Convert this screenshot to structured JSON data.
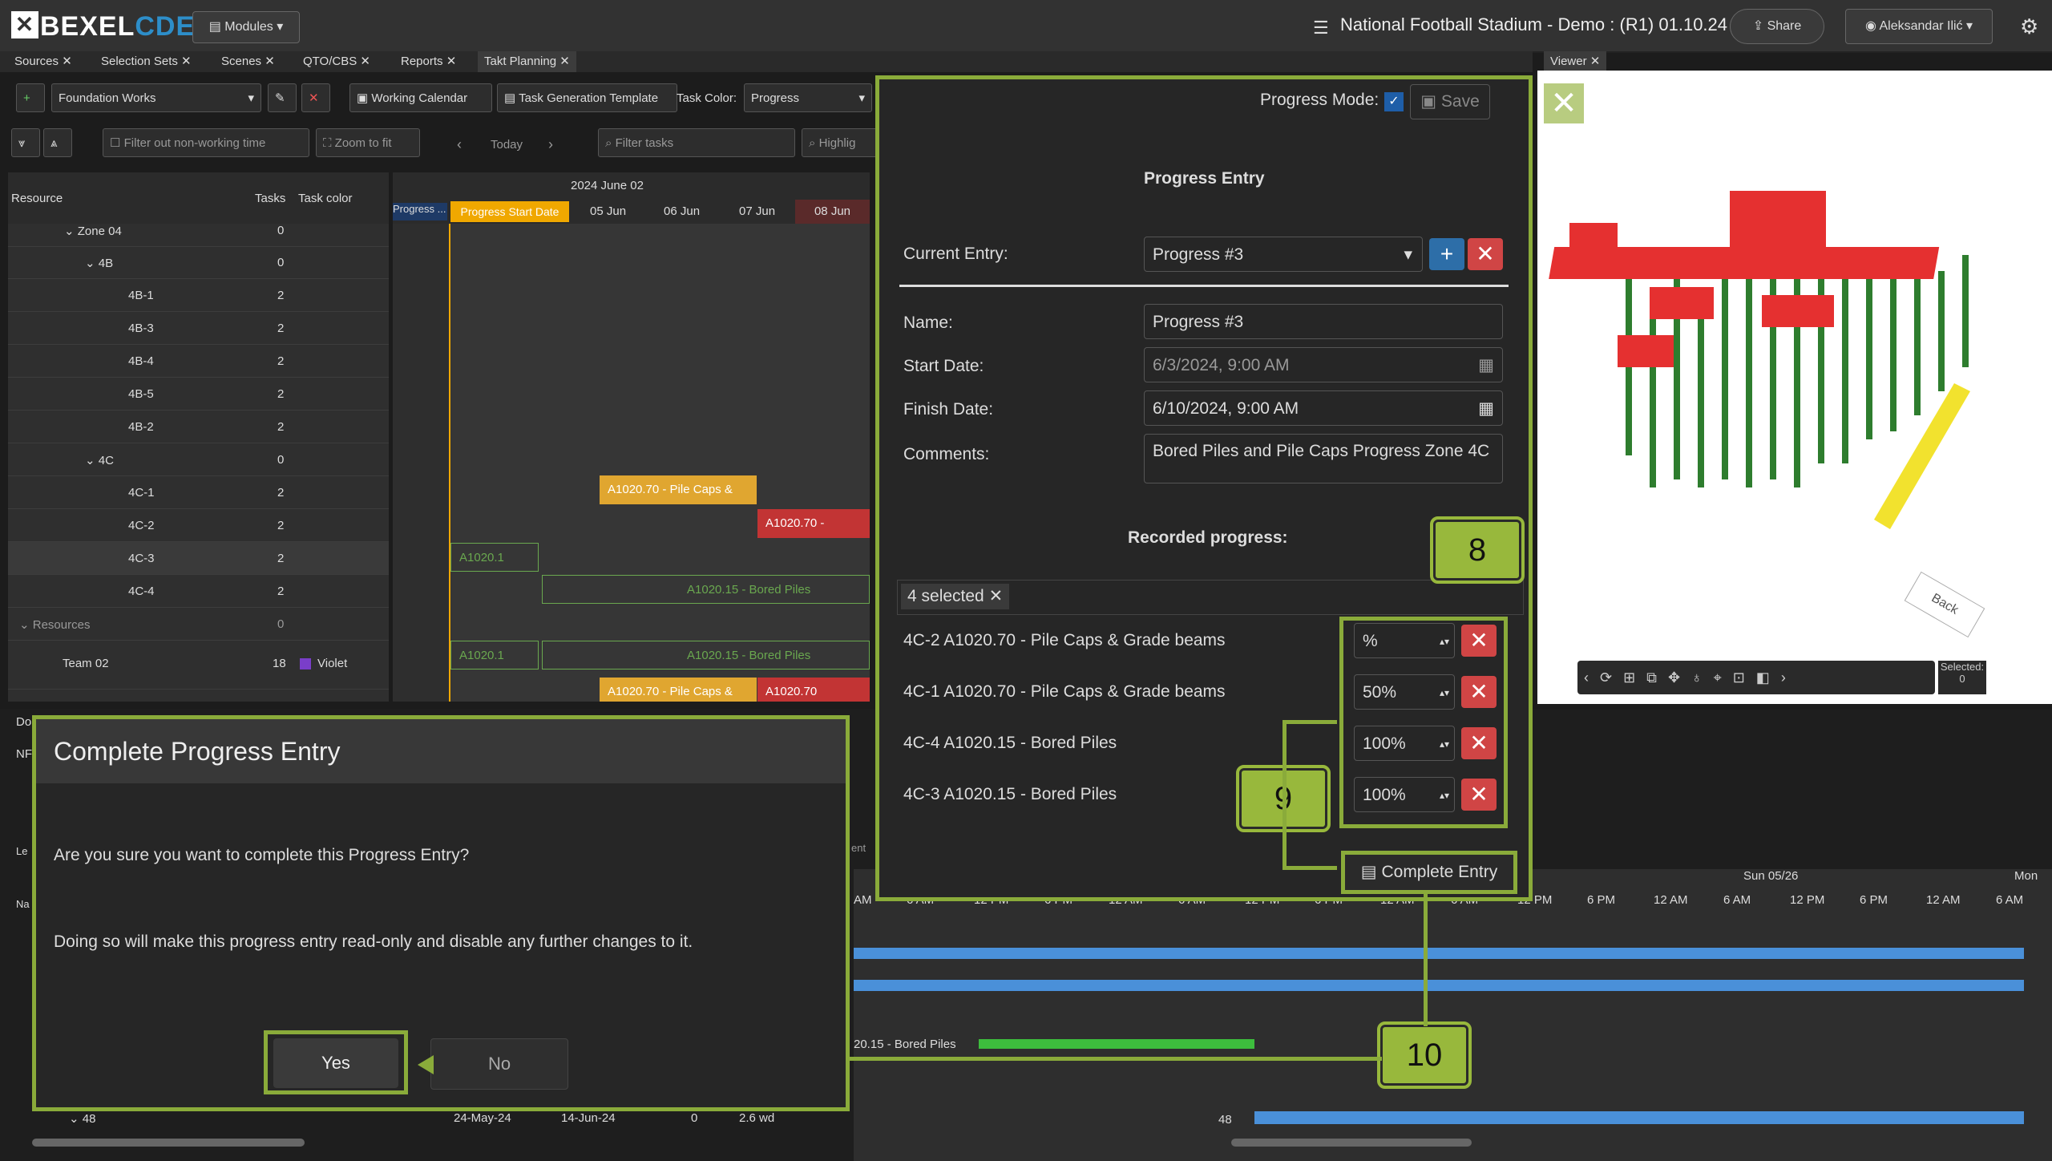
{
  "app": {
    "logo_bexel": "BEXEL",
    "logo_cde": "CDE",
    "modules_label": "Modules",
    "project_title": "National Football Stadium - Demo : (R1) 01.10.24",
    "share_label": "Share",
    "user_name": "Aleksandar Ilić"
  },
  "tabs": [
    "Sources",
    "Selection Sets",
    "Scenes",
    "QTO/CBS",
    "Reports",
    "Takt Planning"
  ],
  "viewer_tab": "Viewer",
  "toolbar": {
    "foundation": "Foundation Works",
    "working_calendar": "Working Calendar",
    "task_template": "Task Generation Template",
    "task_color_label": "Task Color:",
    "task_color_value": "Progress",
    "filter_nonworking": "Filter out non-working time",
    "zoom_to_fit": "Zoom to fit",
    "today": "Today",
    "filter_tasks": "Filter tasks",
    "highlight": "Highlig"
  },
  "gantt": {
    "col_resource": "Resource",
    "col_tasks": "Tasks",
    "col_taskcolor": "Task color",
    "month_label": "2024 June 02",
    "days": [
      "Progress ...",
      "Progress Start Date",
      "05 Jun",
      "06 Jun",
      "07 Jun",
      "08 Jun"
    ],
    "rows": [
      {
        "name": "Zone 04",
        "tasks": "0"
      },
      {
        "name": "4B",
        "tasks": "0"
      },
      {
        "name": "4B-1",
        "tasks": "2"
      },
      {
        "name": "4B-3",
        "tasks": "2"
      },
      {
        "name": "4B-4",
        "tasks": "2"
      },
      {
        "name": "4B-5",
        "tasks": "2"
      },
      {
        "name": "4B-2",
        "tasks": "2"
      },
      {
        "name": "4C",
        "tasks": "0"
      },
      {
        "name": "4C-1",
        "tasks": "2"
      },
      {
        "name": "4C-2",
        "tasks": "2"
      },
      {
        "name": "4C-3",
        "tasks": "2"
      },
      {
        "name": "4C-4",
        "tasks": "2"
      },
      {
        "name": "Resources",
        "tasks": "0"
      },
      {
        "name": "Team 02",
        "tasks": "18",
        "color": "Violet"
      }
    ],
    "bars": [
      "A1020.70 - Pile Caps &",
      "A1020.70 -",
      "A1020.1",
      "A1020.15 - Bored Piles",
      "A1020.1",
      "A1020.15 - Bored Piles",
      "A1020.70 - Pile Caps &",
      "A1020.70"
    ]
  },
  "progress": {
    "mode_label": "Progress Mode:",
    "save_label": "Save",
    "title": "Progress Entry",
    "current_entry_label": "Current Entry:",
    "current_entry_value": "Progress #3",
    "name_label": "Name:",
    "name_value": "Progress #3",
    "start_label": "Start Date:",
    "start_value": "6/3/2024, 9:00 AM",
    "finish_label": "Finish Date:",
    "finish_value": "6/10/2024, 9:00 AM",
    "comments_label": "Comments:",
    "comments_value": "Bored Piles and Pile Caps Progress Zone 4C",
    "recorded_label": "Recorded progress:",
    "selected_chip": "4 selected",
    "items": [
      {
        "label": "4C-2 A1020.70 - Pile Caps & Grade beams",
        "value": "%"
      },
      {
        "label": "4C-1 A1020.70 - Pile Caps & Grade beams",
        "value": "50%"
      },
      {
        "label": "4C-4 A1020.15 - Bored Piles",
        "value": "100%"
      },
      {
        "label": "4C-3 A1020.15 - Bored Piles",
        "value": "100%"
      }
    ],
    "complete_label": "Complete Entry"
  },
  "callouts": {
    "c8": "8",
    "c9": "9",
    "c10": "10"
  },
  "viewer_selected_label": "Selected:",
  "viewer_selected_count": "0",
  "timeline": {
    "date_label": "Sun 05/26",
    "mon_label": "Mon",
    "hours": [
      "AM",
      "6 AM",
      "12 PM",
      "6 PM",
      "12 AM",
      "6 AM",
      "12 PM",
      "6 PM",
      "12 AM",
      "6 AM",
      "12 PM",
      "6 PM",
      "12 AM",
      "6 AM",
      "12 PM",
      "6 PM",
      "12 AM",
      "6 AM"
    ],
    "bored_piles_bar": "20.15 - Bored Piles",
    "row_48": "48",
    "start_date": "24-May-24",
    "end_date": "14-Jun-24",
    "zero": "0",
    "duration": "2.6 wd",
    "row_48_right": "48",
    "ent_fragment": "ent"
  },
  "dialog": {
    "title": "Complete Progress Entry",
    "question": "Are you sure you want to complete this Progress Entry?",
    "warning": "Doing so will make this progress entry read-only and disable any further changes to it.",
    "yes": "Yes",
    "no": "No"
  },
  "fragments": {
    "do": "Do",
    "nf": "NF",
    "le": "Le",
    "na": "Na"
  }
}
